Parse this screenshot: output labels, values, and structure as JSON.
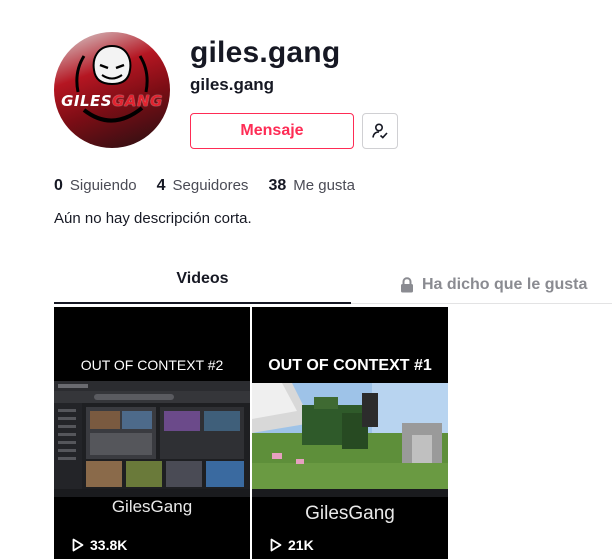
{
  "profile": {
    "avatar_text_1": "GILES",
    "avatar_text_2": "GANG",
    "title": "giles.gang",
    "subtitle": "giles.gang",
    "message_label": "Mensaje",
    "bio": "Aún no hay descripción corta.",
    "accent_color": "#fe2c55"
  },
  "stats": [
    {
      "value": "0",
      "label": "Siguiendo"
    },
    {
      "value": "4",
      "label": "Seguidores"
    },
    {
      "value": "38",
      "label": "Me gusta"
    }
  ],
  "tabs": {
    "videos": "Videos",
    "liked": "Ha dicho que le gusta"
  },
  "videos": [
    {
      "title": "OUT OF CONTEXT #2",
      "brand": "GilesGang",
      "plays": "33.8K"
    },
    {
      "title": "OUT OF CONTEXT #1",
      "brand": "GilesGang",
      "plays": "21K"
    }
  ],
  "icons": {
    "follow": "user-check-icon",
    "lock": "lock-icon",
    "play": "play-icon"
  }
}
